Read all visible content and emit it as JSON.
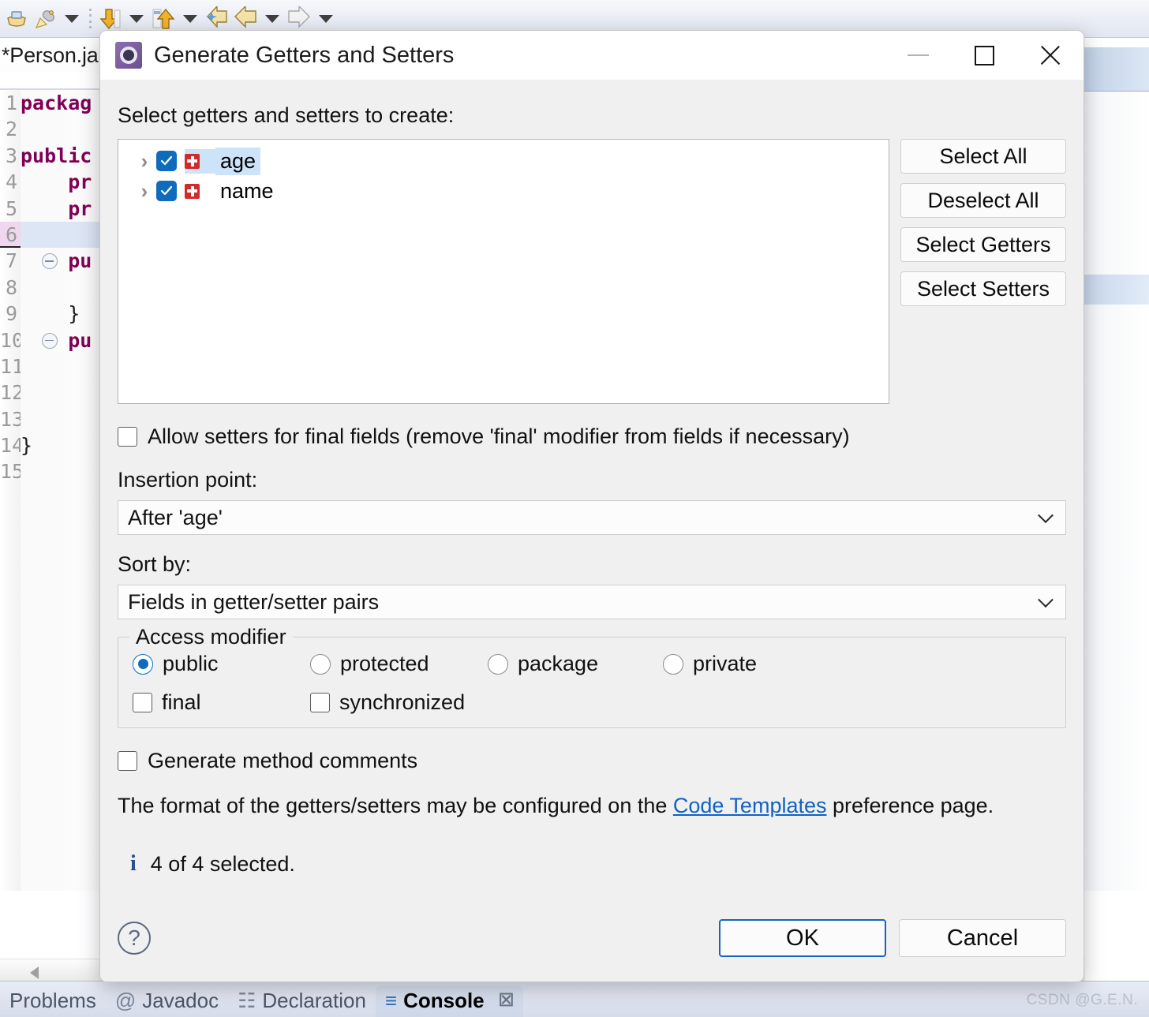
{
  "background": {
    "editor_tab_title": "*Person.ja",
    "code_lines": [
      {
        "n": "1",
        "text": "packag",
        "kw": true
      },
      {
        "n": "2",
        "text": "",
        "kw": false
      },
      {
        "n": "3",
        "text": "public",
        "kw": true
      },
      {
        "n": "4",
        "text": "    pr",
        "kw": true
      },
      {
        "n": "5",
        "text": "    pr",
        "kw": true
      },
      {
        "n": "6",
        "text": "",
        "kw": false
      },
      {
        "n": "7",
        "text": "    pu",
        "kw": true
      },
      {
        "n": "8",
        "text": "",
        "kw": false
      },
      {
        "n": "9",
        "text": "    }",
        "kw": false
      },
      {
        "n": "10",
        "text": "    pu",
        "kw": true
      },
      {
        "n": "11",
        "text": "",
        "kw": false
      },
      {
        "n": "12",
        "text": "",
        "kw": false
      },
      {
        "n": "13",
        "text": "",
        "kw": false
      },
      {
        "n": "14",
        "text": "}",
        "kw": false
      },
      {
        "n": "15",
        "text": "",
        "kw": false
      }
    ],
    "bottom_tabs": [
      {
        "label": "Problems",
        "icon": "",
        "active": false
      },
      {
        "label": "Javadoc",
        "icon": "@",
        "active": false
      },
      {
        "label": "Declaration",
        "icon": "☷",
        "active": false
      },
      {
        "label": "Console",
        "icon": "≡",
        "active": true
      }
    ],
    "watermark": "CSDN @G.E.N."
  },
  "dialog": {
    "title": "Generate Getters and Setters",
    "window_controls": {
      "minimize": "minimize-button",
      "maximize": "maximize-button",
      "close": "close-button"
    },
    "tree_label": "Select getters and setters to create:",
    "tree_items": [
      {
        "name": "age",
        "checked": true,
        "selected": true,
        "expandable": true
      },
      {
        "name": "name",
        "checked": true,
        "selected": false,
        "expandable": true
      }
    ],
    "side_buttons": [
      "Select All",
      "Deselect All",
      "Select Getters",
      "Select Setters"
    ],
    "allow_setters_final": {
      "label": "Allow setters for final fields (remove 'final' modifier from fields if necessary)",
      "checked": false
    },
    "insertion_point": {
      "label": "Insertion point:",
      "value": "After 'age'"
    },
    "sort_by": {
      "label": "Sort by:",
      "value": "Fields in getter/setter pairs"
    },
    "access_modifier": {
      "title": "Access modifier",
      "radios": [
        {
          "label": "public",
          "selected": true
        },
        {
          "label": "protected",
          "selected": false
        },
        {
          "label": "package",
          "selected": false
        },
        {
          "label": "private",
          "selected": false
        }
      ],
      "checkboxes": [
        {
          "label": "final",
          "checked": false
        },
        {
          "label": "synchronized",
          "checked": false
        }
      ]
    },
    "generate_comments": {
      "label": "Generate method comments",
      "checked": false
    },
    "format_note": {
      "prefix": "The format of the getters/setters may be configured on the ",
      "link": "Code Templates",
      "suffix": " preference page."
    },
    "status": {
      "icon": "i",
      "text": "4 of 4 selected."
    },
    "footer": {
      "help": "?",
      "ok": "OK",
      "cancel": "Cancel"
    }
  },
  "colors": {
    "accent": "#0f6cbd",
    "link": "#1062c4",
    "selection": "#cde3f7",
    "field_icon": "#cf2b2b",
    "keyword": "#7f0055",
    "dialog_bg": "#f0f0f0"
  }
}
